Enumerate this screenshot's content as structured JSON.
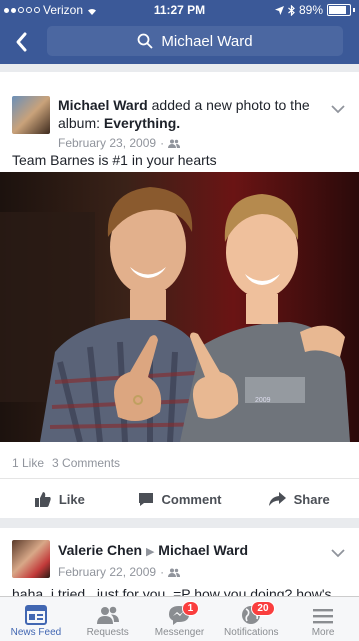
{
  "status_bar": {
    "carrier": "Verizon",
    "time": "11:27 PM",
    "battery": "89%",
    "battery_level": 0.89
  },
  "search": {
    "query": "Michael Ward"
  },
  "post1": {
    "author": "Michael Ward",
    "action_text": "added a new photo to the album:",
    "album": "Everything.",
    "date": "February 23, 2009",
    "privacy_sep": "·",
    "text": "Team Barnes is #1 in your hearts",
    "likes": "1 Like",
    "comments": "3 Comments",
    "actions": {
      "like": "Like",
      "comment": "Comment",
      "share": "Share"
    },
    "photo_shirt_text": "2009"
  },
  "post2": {
    "author": "Valerie Chen",
    "arrow": "▶",
    "target": "Michael Ward",
    "date": "February 22, 2009",
    "privacy_sep": "·",
    "text": "haha, i tried...just for you.  =P  how you doing?  how's"
  },
  "tabbar": {
    "items": [
      {
        "label": "News Feed",
        "icon": "news-feed-icon",
        "badge": ""
      },
      {
        "label": "Requests",
        "icon": "friend-requests-icon",
        "badge": ""
      },
      {
        "label": "Messenger",
        "icon": "messenger-icon",
        "badge": "1"
      },
      {
        "label": "Notifications",
        "icon": "globe-icon",
        "badge": "20"
      },
      {
        "label": "More",
        "icon": "menu-icon",
        "badge": ""
      }
    ]
  },
  "colors": {
    "brand": "#3b5998",
    "search_bg": "#4b67a1",
    "link_active": "#4267b2",
    "badge": "#fa3e3e"
  }
}
